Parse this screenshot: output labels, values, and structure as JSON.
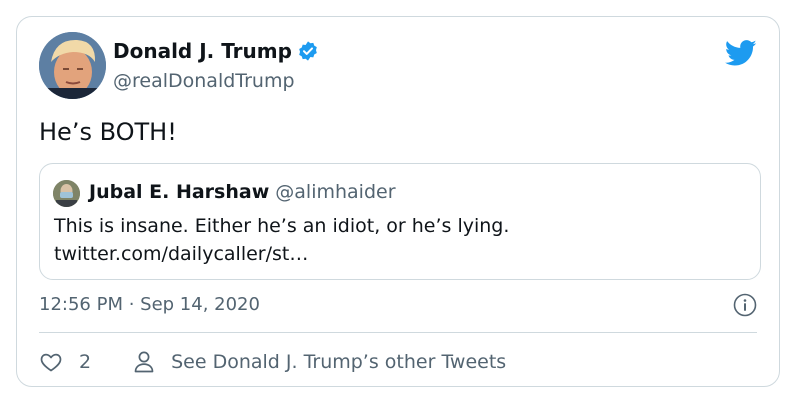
{
  "author": {
    "name": "Donald J. Trump",
    "handle": "@realDonaldTrump",
    "verified": true,
    "avatar_icon": "avatar-photo"
  },
  "tweet": {
    "text": "He’s BOTH!"
  },
  "quoted_tweet": {
    "name": "Jubal E. Harshaw",
    "handle": "@alimhaider",
    "line1": "This is insane. Either he’s an idiot, or he’s lying.",
    "line2": "twitter.com/dailycaller/st…"
  },
  "meta": {
    "timestamp": "12:56 PM · Sep 14, 2020"
  },
  "actions": {
    "like_count": "2",
    "other_tweets_label": "See Donald J. Trump’s other Tweets"
  },
  "colors": {
    "twitter_blue": "#1d9bf0",
    "secondary_text": "#536471",
    "border": "#cfd9de"
  }
}
